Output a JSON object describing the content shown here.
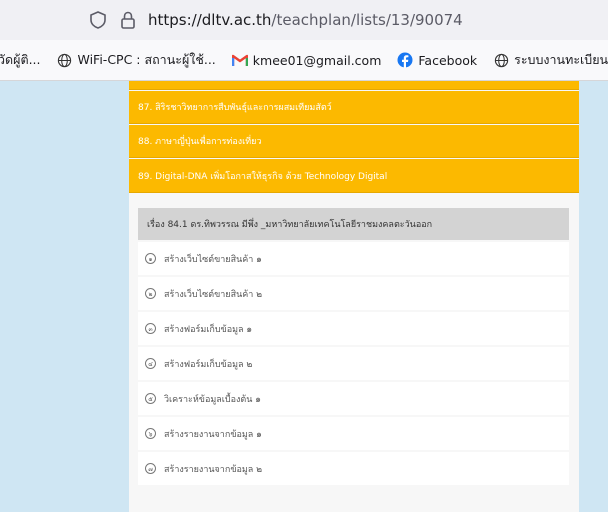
{
  "browser": {
    "url_host": "https://dltv.ac.th",
    "url_path": "/teachplan/lists/13/90074",
    "icons": [
      "shield-icon",
      "lock-icon"
    ]
  },
  "bookmarks": [
    {
      "label": "วัดผู้ติ...",
      "icon": "none"
    },
    {
      "label": "WiFi-CPC : สถานะผู้ใช้...",
      "icon": "globe-icon"
    },
    {
      "label": "kmee01@gmail.com",
      "icon": "gmail-icon"
    },
    {
      "label": "Facebook",
      "icon": "facebook-icon"
    },
    {
      "label": "ระบบงานทะเบียน",
      "icon": "globe-icon"
    }
  ],
  "menu": {
    "items": [
      {
        "label": "87. สิริรชาวิทยาการสืบพันธุ์และการผสมเทียมสัตว์"
      },
      {
        "label": "88. ภาษาญี่ปุ่นเพื่อการท่องเที่ยว"
      },
      {
        "label": "89. Digital-DNA เพิ่มโอกาสให้ธุรกิจ ด้วย Technology Digital"
      }
    ]
  },
  "lesson": {
    "header": "เรื่อง 84.1 ดร.ทิพวรรณ มีพึ่ง _มหาวิทยาลัยเทคโนโลยีราชมงคลตะวันออก",
    "items": [
      {
        "num": "๑",
        "label": "สร้างเว็บไซต์ขายสินค้า ๑"
      },
      {
        "num": "๒",
        "label": "สร้างเว็บไซต์ขายสินค้า ๒"
      },
      {
        "num": "๓",
        "label": "สร้างฟอร์มเก็บข้อมูล ๑"
      },
      {
        "num": "๔",
        "label": "สร้างฟอร์มเก็บข้อมูล ๒"
      },
      {
        "num": "๕",
        "label": "วิเคราะห์ข้อมูลเบื้องต้น ๑"
      },
      {
        "num": "๖",
        "label": "สร้างรายงานจากข้อมูล ๑"
      },
      {
        "num": "๗",
        "label": "สร้างรายงานจากข้อมูล ๒"
      }
    ]
  },
  "colors": {
    "menu_bg": "#fcb900",
    "page_bg": "#cfe6f3",
    "header_bg": "#d3d3d3"
  }
}
